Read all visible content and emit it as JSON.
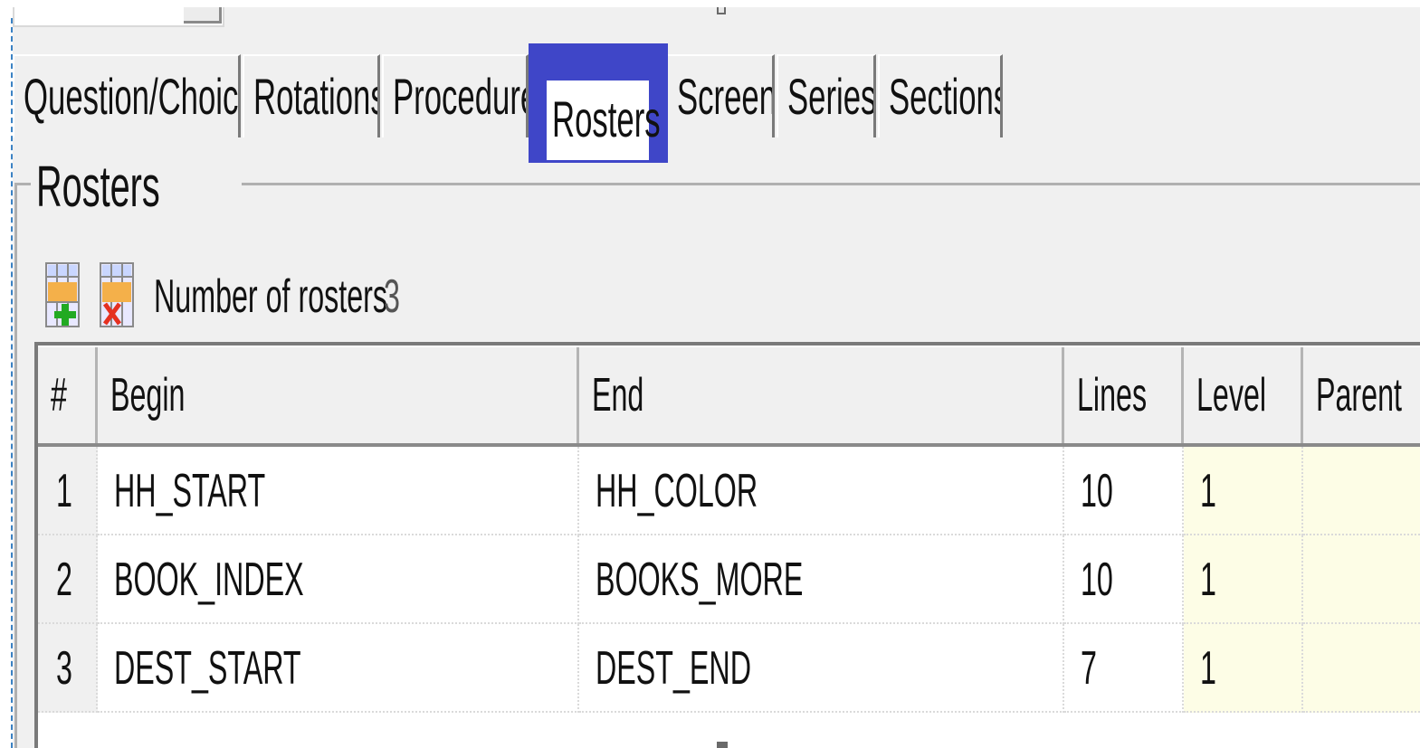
{
  "tabs": [
    {
      "label": "Question/Choices"
    },
    {
      "label": "Rotations"
    },
    {
      "label": "Procedures"
    },
    {
      "label": "Rosters",
      "selected": true
    },
    {
      "label": "Screens"
    },
    {
      "label": "Series"
    },
    {
      "label": "Sections"
    }
  ],
  "rosters_panel": {
    "title": "Rosters",
    "count_label": "Number of rosters",
    "count_value": "3"
  },
  "grid": {
    "columns": [
      "#",
      "Begin",
      "End",
      "Lines",
      "Level",
      "Parent"
    ],
    "rows": [
      {
        "num": "1",
        "begin": "HH_START",
        "end": "HH_COLOR",
        "lines": "10",
        "level": "1",
        "parent": ""
      },
      {
        "num": "2",
        "begin": "BOOK_INDEX",
        "end": "BOOKS_MORE",
        "lines": "10",
        "level": "1",
        "parent": ""
      },
      {
        "num": "3",
        "begin": "DEST_START",
        "end": "DEST_END",
        "lines": "7",
        "level": "1",
        "parent": ""
      }
    ]
  },
  "icons": {
    "add": "add-roster-icon",
    "delete": "delete-roster-icon"
  },
  "colors": {
    "selected_tab_highlight": "#3f46c8",
    "editable_cell_bg": "#fdfde6",
    "panel_bg": "#f0f0f0"
  }
}
